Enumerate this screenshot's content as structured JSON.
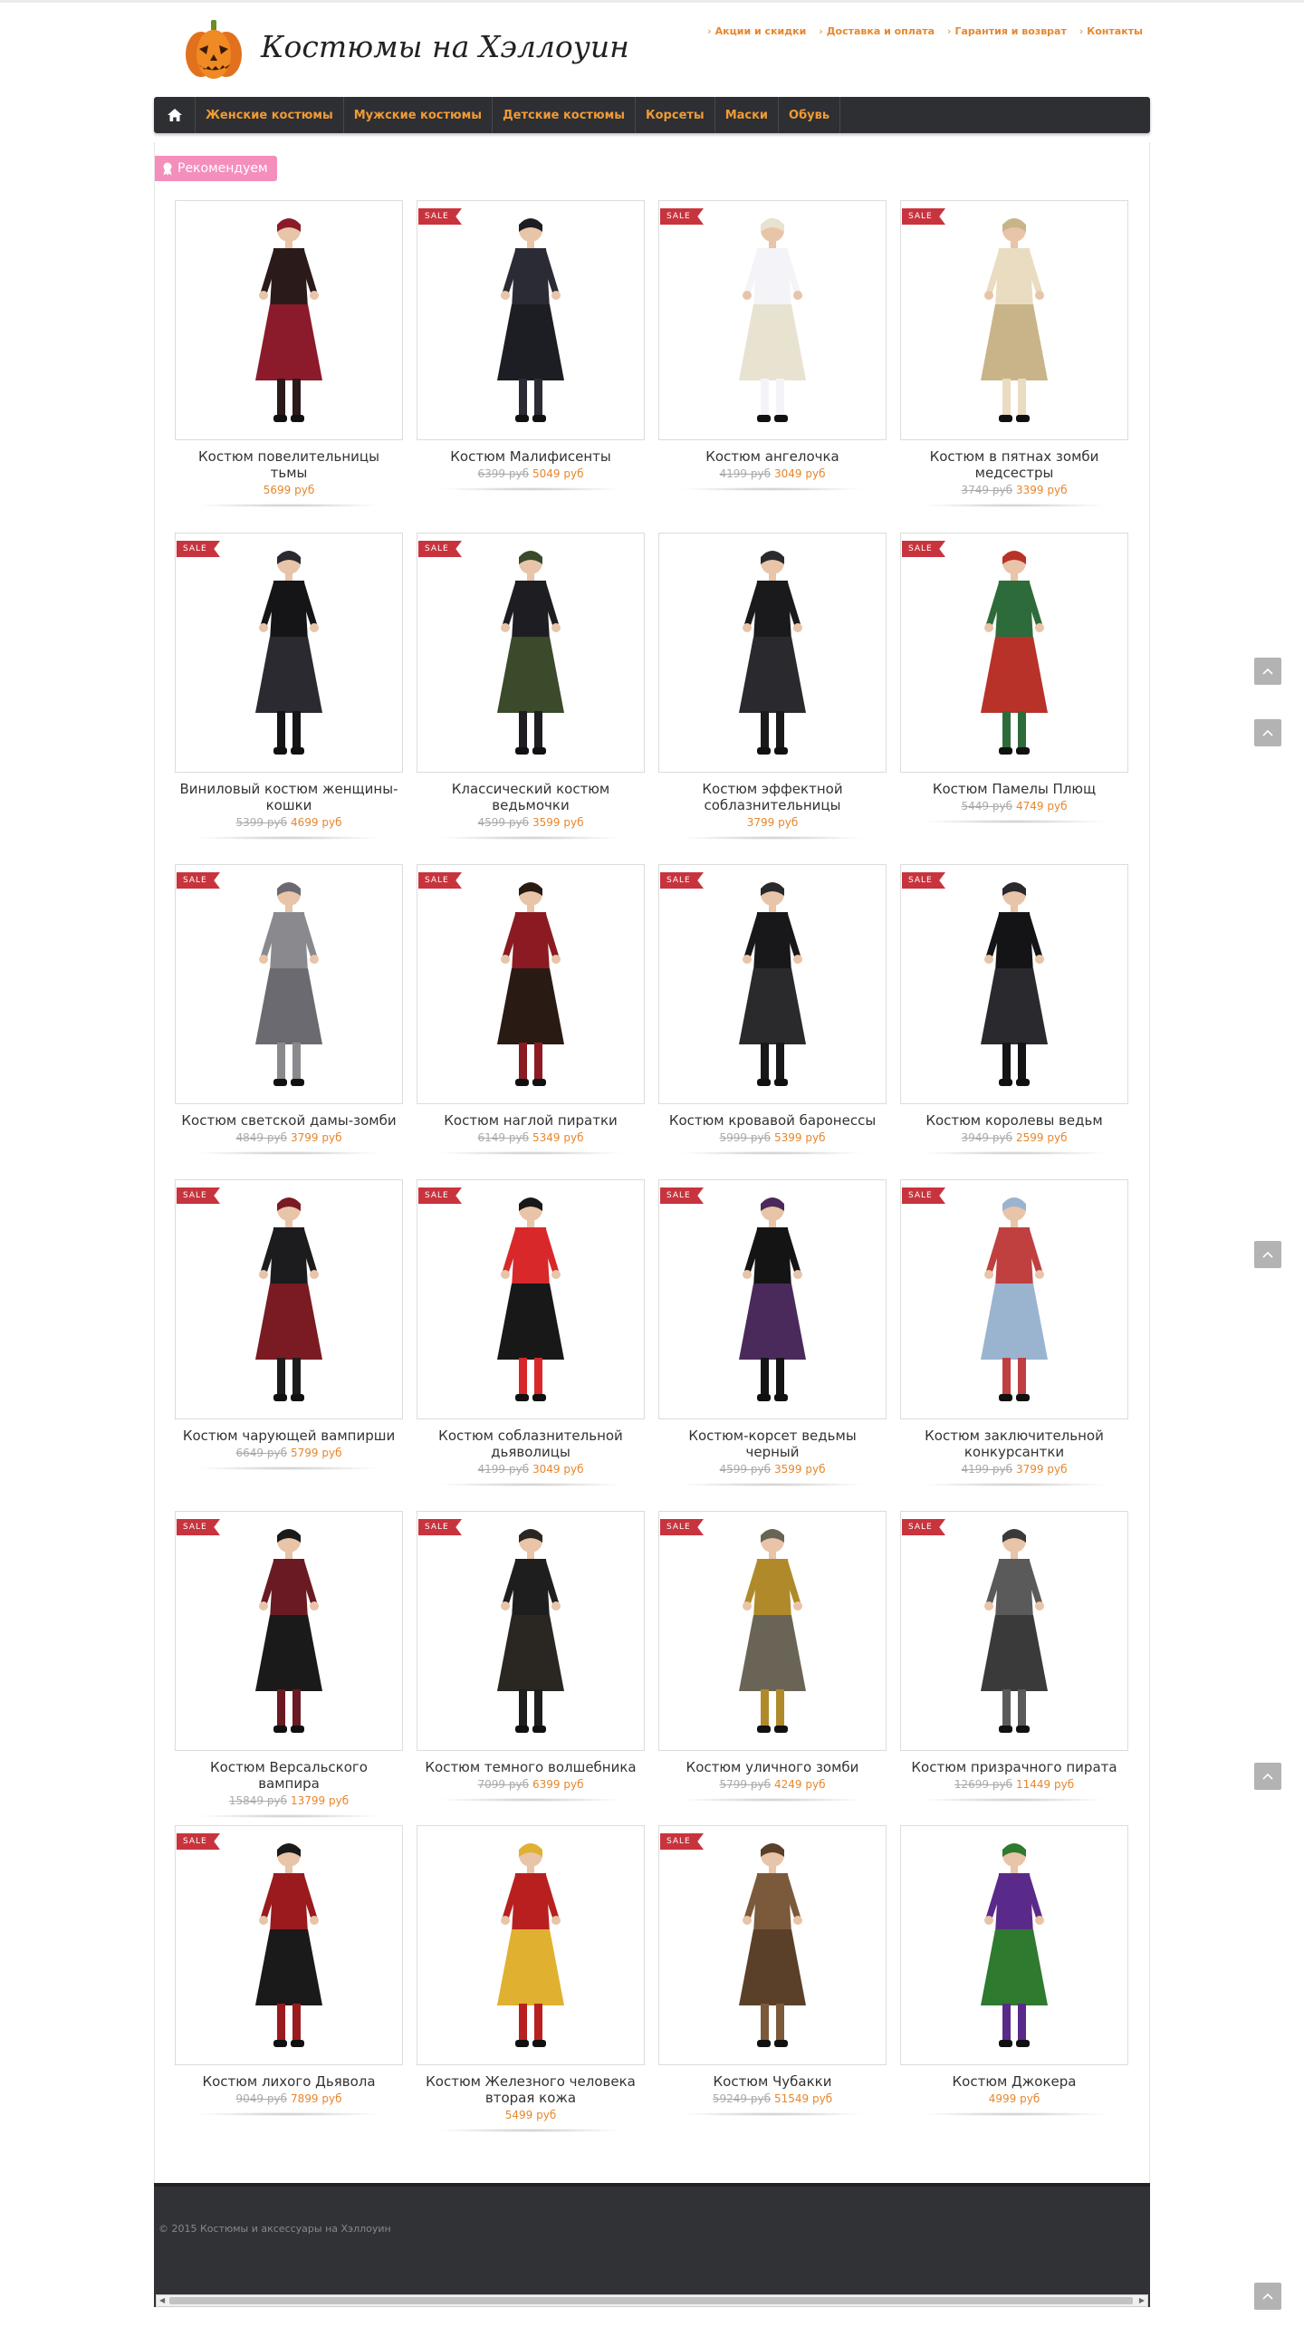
{
  "site": {
    "title": "Костюмы на Хэллоуин",
    "top_links": [
      "Акции и скидки",
      "Доставка и оплата",
      "Гарантия и возврат",
      "Контакты"
    ]
  },
  "nav": {
    "home_icon": "home-icon",
    "items": [
      "Женские костюмы",
      "Мужские костюмы",
      "Детские костюмы",
      "Корсеты",
      "Маски",
      "Обувь"
    ]
  },
  "section": {
    "label": "Рекомендуем",
    "icon": "ribbon-icon"
  },
  "sale_label": "SALE",
  "colors": {
    "accent": "#e8862c",
    "nav_bg": "#2d2f33",
    "sale": "#c8343e",
    "badge_pink": "#f48fbc",
    "footer_bg": "#313236"
  },
  "products": [
    {
      "name": "Костюм повелительницы тьмы",
      "old_price": "",
      "price": "5699 руб",
      "sale": false
    },
    {
      "name": "Костюм Малифисенты",
      "old_price": "6399 руб",
      "price": "5049 руб",
      "sale": true
    },
    {
      "name": "Костюм ангелочка",
      "old_price": "4199 руб",
      "price": "3049 руб",
      "sale": true
    },
    {
      "name": "Костюм в пятнах зомби медсестры",
      "old_price": "3749 руб",
      "price": "3399 руб",
      "sale": true
    },
    {
      "name": "Виниловый костюм женщины-кошки",
      "old_price": "5399 руб",
      "price": "4699 руб",
      "sale": true
    },
    {
      "name": "Классический костюм ведьмочки",
      "old_price": "4599 руб",
      "price": "3599 руб",
      "sale": true
    },
    {
      "name": "Костюм эффектной соблазнительницы",
      "old_price": "",
      "price": "3799 руб",
      "sale": false
    },
    {
      "name": "Костюм Памелы Плющ",
      "old_price": "5449 руб",
      "price": "4749 руб",
      "sale": true
    },
    {
      "name": "Костюм светской дамы-зомби",
      "old_price": "4849 руб",
      "price": "3799 руб",
      "sale": true
    },
    {
      "name": "Костюм наглой пиратки",
      "old_price": "6149 руб",
      "price": "5349 руб",
      "sale": true
    },
    {
      "name": "Костюм кровавой баронессы",
      "old_price": "5999 руб",
      "price": "5399 руб",
      "sale": true
    },
    {
      "name": "Костюм королевы ведьм",
      "old_price": "3949 руб",
      "price": "2599 руб",
      "sale": true
    },
    {
      "name": "Костюм чарующей вампирши",
      "old_price": "6649 руб",
      "price": "5799 руб",
      "sale": true
    },
    {
      "name": "Костюм соблазнительной дьяволицы",
      "old_price": "4199 руб",
      "price": "3049 руб",
      "sale": true
    },
    {
      "name": "Костюм-корсет ведьмы черный",
      "old_price": "4599 руб",
      "price": "3599 руб",
      "sale": true
    },
    {
      "name": "Костюм заключительной конкурсантки",
      "old_price": "4199 руб",
      "price": "3799 руб",
      "sale": true
    },
    {
      "name": "Костюм Версальского вампира",
      "old_price": "15849 руб",
      "price": "13799 руб",
      "sale": true
    },
    {
      "name": "Костюм темного волшебника",
      "old_price": "7099 руб",
      "price": "6399 руб",
      "sale": true
    },
    {
      "name": "Костюм уличного зомби",
      "old_price": "5799 руб",
      "price": "4249 руб",
      "sale": true
    },
    {
      "name": "Костюм призрачного пирата",
      "old_price": "12699 руб",
      "price": "11449 руб",
      "sale": true
    },
    {
      "name": "Костюм лихого Дьявола",
      "old_price": "9049 руб",
      "price": "7899 руб",
      "sale": true
    },
    {
      "name": "Костюм Железного человека вторая кожа",
      "old_price": "",
      "price": "5499 руб",
      "sale": false
    },
    {
      "name": "Костюм Чубакки",
      "old_price": "59249 руб",
      "price": "51549 руб",
      "sale": true
    },
    {
      "name": "Костюм Джокера",
      "old_price": "",
      "price": "4999 руб",
      "sale": false
    }
  ],
  "footer": {
    "copyright": "© 2015 Костюмы и аксессуары на Хэллоуин"
  }
}
